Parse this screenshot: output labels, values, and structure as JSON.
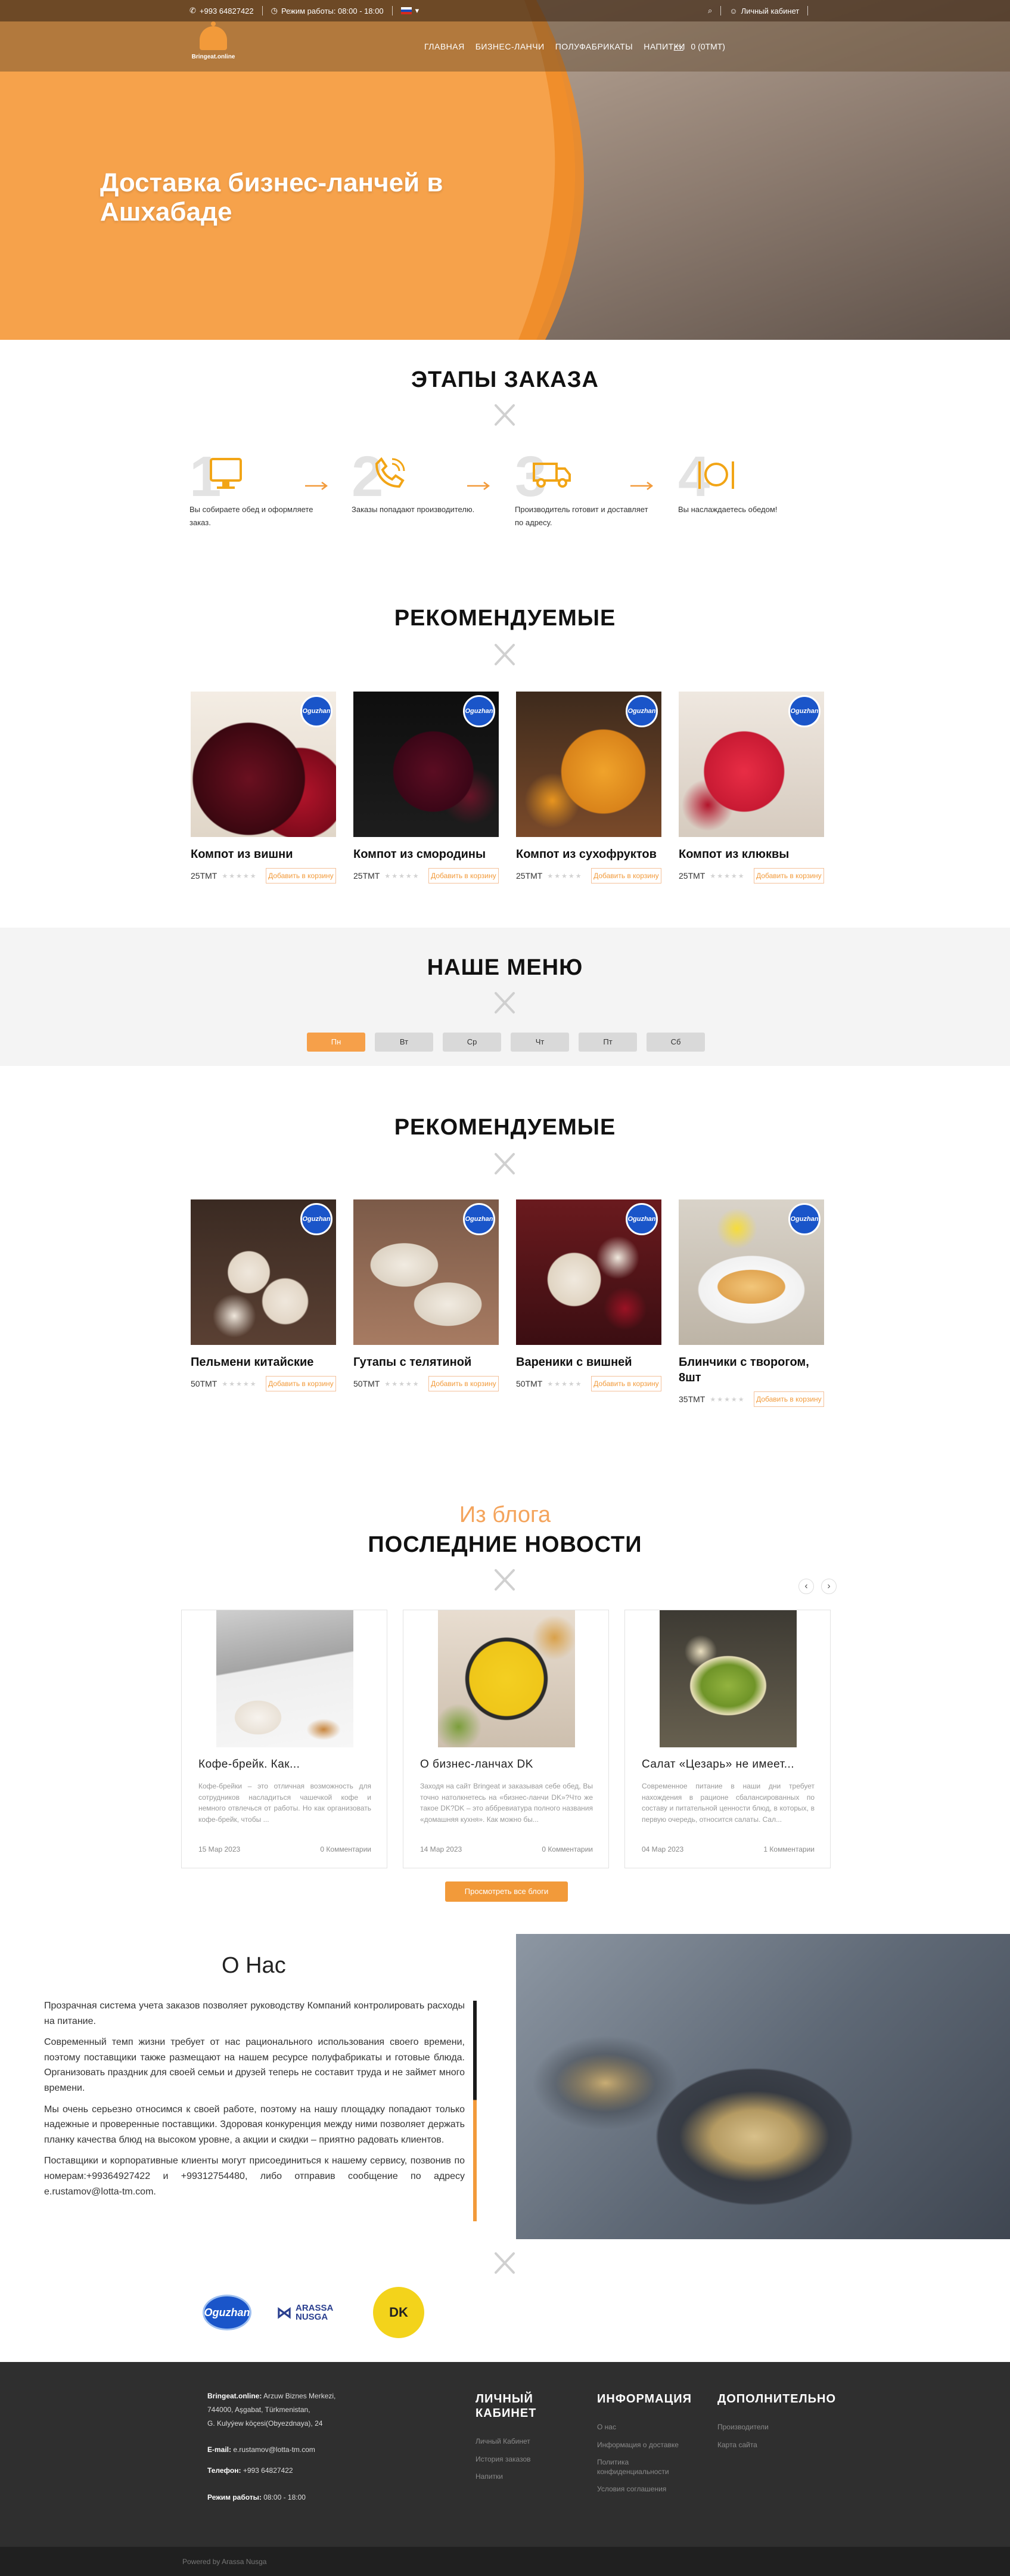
{
  "topbar": {
    "phone": "+993 64827422",
    "hours": "Режим работы: 08:00 - 18:00",
    "account": "Личный кабинет"
  },
  "logo": {
    "text": "Bringeat.online"
  },
  "nav": {
    "links": [
      "ГЛАВНАЯ",
      "БИЗНЕС-ЛАНЧИ",
      "ПОЛУФАБРИКАТЫ",
      "НАПИТКИ"
    ],
    "cart": "0 (0TMT)"
  },
  "hero": {
    "title": "Доставка бизнес-ланчей в Ашхабаде"
  },
  "steps": {
    "title": "ЭТАПЫ ЗАКАЗА",
    "items": [
      {
        "num": "1",
        "icon": "computer-icon",
        "text": "Вы собираете обед и оформляете заказ."
      },
      {
        "num": "2",
        "icon": "phone-icon",
        "text": "Заказы попадают производителю."
      },
      {
        "num": "3",
        "icon": "truck-icon",
        "text": "Производитель готовит и доставляет по адресу."
      },
      {
        "num": "4",
        "icon": "cutlery-icon",
        "text": "Вы наслаждаетесь обедом!"
      }
    ]
  },
  "recommended1": {
    "title": "РЕКОМЕНДУЕМЫЕ",
    "items": [
      {
        "name": "Компот из вишни",
        "price": "25TMT",
        "button": "Добавить в корзину"
      },
      {
        "name": "Компот из смородины",
        "price": "25TMT",
        "button": "Добавить в корзину"
      },
      {
        "name": "Компот из сухофруктов",
        "price": "25TMT",
        "button": "Добавить в корзину"
      },
      {
        "name": "Компот из клюквы",
        "price": "25TMT",
        "button": "Добавить в корзину"
      }
    ]
  },
  "menu": {
    "title": "НАШЕ МЕНЮ",
    "days": [
      "Пн",
      "Вт",
      "Ср",
      "Чт",
      "Пт",
      "Сб"
    ]
  },
  "recommended2": {
    "title": "РЕКОМЕНДУЕМЫЕ",
    "items": [
      {
        "name": "Пельмени китайские",
        "price": "50TMT",
        "button": "Добавить в корзину"
      },
      {
        "name": "Гутапы с телятиной",
        "price": "50TMT",
        "button": "Добавить в корзину"
      },
      {
        "name": "Вареники с вишней",
        "price": "50TMT",
        "button": "Добавить в корзину"
      },
      {
        "name": "Блинчики с творогом, 8шт",
        "price": "35TMT",
        "button": "Добавить в корзину"
      }
    ]
  },
  "badge": "Oguzhan",
  "blog": {
    "subtitle": "Из блога",
    "title": "ПОСЛЕДНИЕ НОВОСТИ",
    "posts": [
      {
        "title": "Кофе-брейк. Как...",
        "text": "Кофе-брейки – это отличная возможность для сотрудников насладиться чашечкой кофе и немного отвлечься от работы. Но как организовать кофе-брейк, чтобы ...",
        "date": "15 Мар 2023",
        "comments": "0 Комментарии"
      },
      {
        "title": "О бизнес-ланчах DK",
        "text": "Заходя на сайт Bringeat и заказывая себе обед, Вы точно натолкнетесь на «бизнес-ланчи DK»?Что же такое DK?DK – это аббревиатура полного названия «домашняя кухня». Как можно бы...",
        "date": "14 Мар 2023",
        "comments": "0 Комментарии"
      },
      {
        "title": "Салат «Цезарь» не имеет...",
        "text": "Современное питание в наши дни требует нахождения в рационе сбалансированных по составу и питательной ценности блюд, в которых, в первую очередь, относится салаты. Сал...",
        "date": "04 Мар 2023",
        "comments": "1 Комментарии"
      }
    ],
    "view_all": "Просмотреть все блоги"
  },
  "about": {
    "title": "О Нас",
    "paragraphs": [
      "Прозрачная система учета заказов позволяет руководству Компаний контролировать расходы на питание.",
      "Современный темп жизни требует от нас рационального использования своего времени, поэтому поставщики также размещают на нашем ресурсе полуфабрикаты и готовые блюда. Организовать праздник для своей семьи и друзей теперь не составит труда и не займет много времени.",
      "Мы очень серьезно относимся к своей работе, поэтому на нашу площадку попадают только надежные и проверенные поставщики. Здоровая конкуренция между ними позволяет держать планку качества блюд на высоком уровне, а акции и скидки – приятно радовать клиентов.",
      "Поставщики и корпоративные клиенты могут присоединиться к нашему сервису, позвонив по номерам:+99364927422 и +99312754480, либо отправив сообщение по адресу e.rustamov@lotta-tm.com."
    ]
  },
  "partners": {
    "logo1": "Oguzhan",
    "logo2_line1": "ARASSA",
    "logo2_line2": "NUSGA",
    "logo3": "DK"
  },
  "footer": {
    "company_label": "Bringeat.online:",
    "company_addr1": "Arzuw Biznes Merkezi,",
    "company_addr2": "744000, Aşgabat, Türkmenistan,",
    "company_addr3": "G. Kulyýew köçesi(Obyezdnaya), 24",
    "email_label": "E-mail:",
    "email": "e.rustamov@lotta-tm.com",
    "phone_label": "Телефон:",
    "phone": "+993 64827422",
    "hours_label": "Режим работы:",
    "hours": "08:00 - 18:00",
    "col1": {
      "title": "ЛИЧНЫЙ КАБИНЕТ",
      "links": [
        "Личный Кабинет",
        "История заказов",
        "Напитки"
      ]
    },
    "col2": {
      "title": "ИНФОРМАЦИЯ",
      "links": [
        "О нас",
        "Информация о доставке",
        "Политика конфиденциальности",
        "Условия соглашения"
      ]
    },
    "col3": {
      "title": "ДОПОЛНИТЕЛЬНО",
      "links": [
        "Производители",
        "Карта сайта"
      ]
    },
    "powered": "Powered by Arassa Nusga"
  },
  "colors": {
    "accent": "#f29a3a",
    "footer": "#2f2f2f",
    "badge": "#1a55c9"
  }
}
